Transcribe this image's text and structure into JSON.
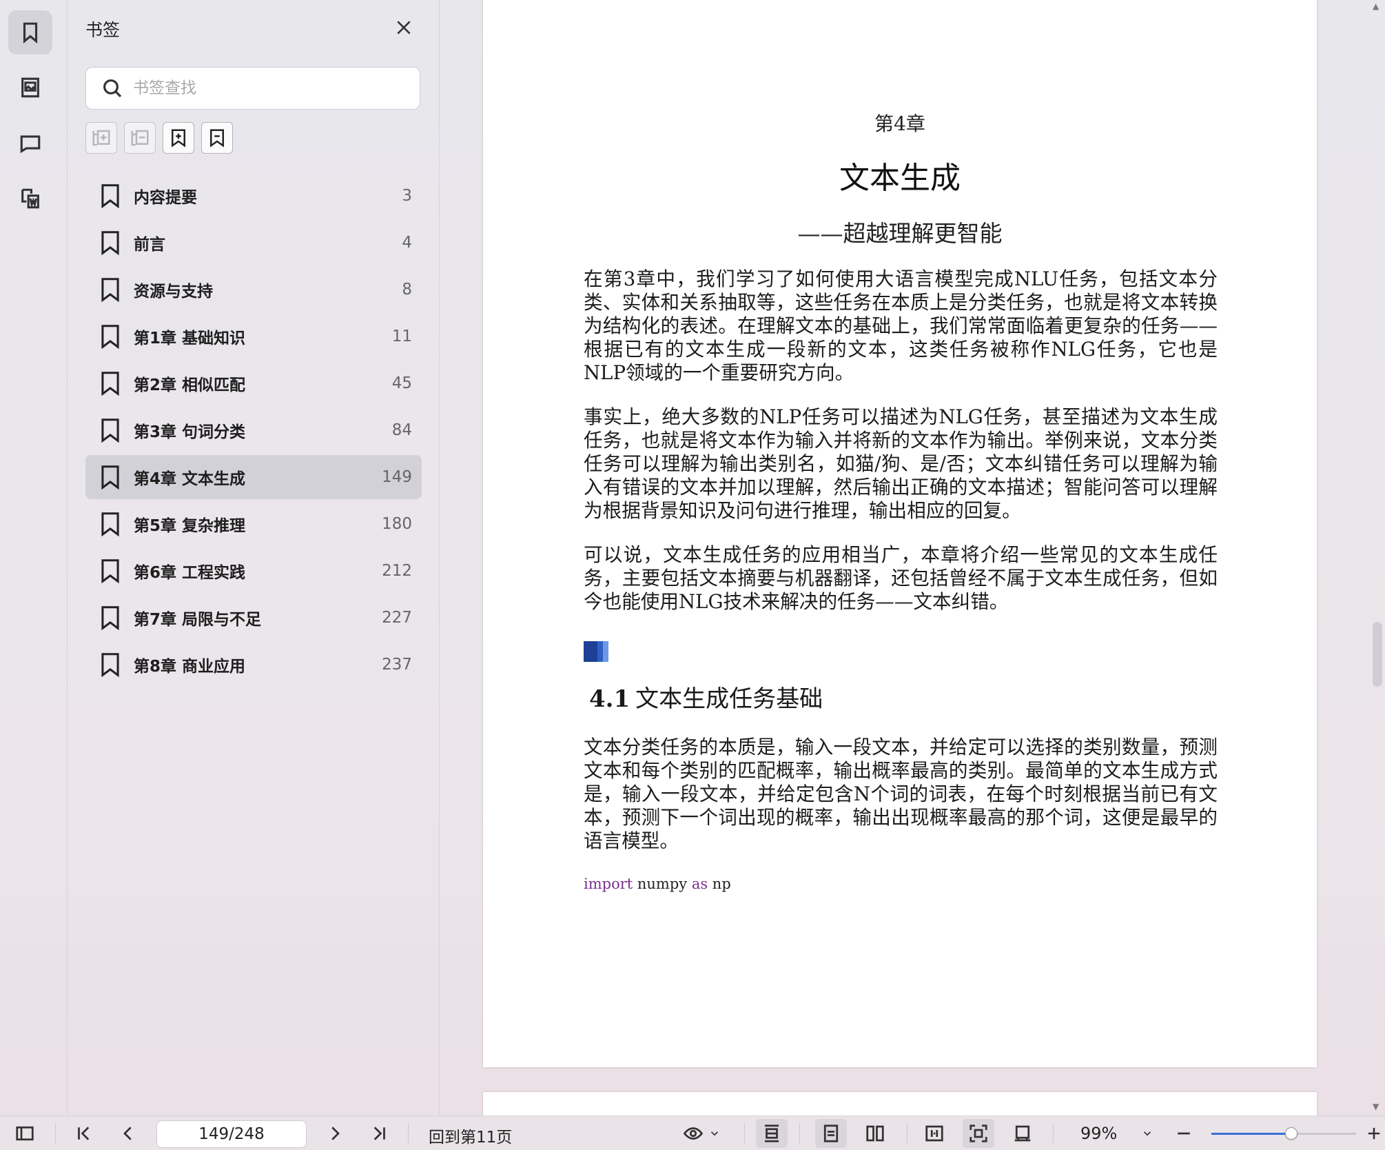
{
  "sidebar_panel": {
    "title": "书签",
    "search_placeholder": "书签查找",
    "items": [
      {
        "label": "内容提要",
        "page": "3"
      },
      {
        "label": "前言",
        "page": "4"
      },
      {
        "label": "资源与支持",
        "page": "8"
      },
      {
        "label": "第1章 基础知识",
        "page": "11"
      },
      {
        "label": "第2章 相似匹配",
        "page": "45"
      },
      {
        "label": "第3章 句词分类",
        "page": "84"
      },
      {
        "label": "第4章 文本生成",
        "page": "149"
      },
      {
        "label": "第5章 复杂推理",
        "page": "180"
      },
      {
        "label": "第6章 工程实践",
        "page": "212"
      },
      {
        "label": "第7章 局限与不足",
        "page": "227"
      },
      {
        "label": "第8章 商业应用",
        "page": "237"
      }
    ],
    "selected_index": 6
  },
  "document": {
    "chapter_number": "第4章",
    "chapter_title": "文本生成",
    "chapter_subtitle": "——超越理解更智能",
    "paragraphs": [
      "在第3章中，我们学习了如何使用大语言模型完成NLU任务，包括文本分类、实体和关系抽取等，这些任务在本质上是分类任务，也就是将文本转换为结构化的表述。在理解文本的基础上，我们常常面临着更复杂的任务——根据已有的文本生成一段新的文本，这类任务被称作NLG任务，它也是NLP领域的一个重要研究方向。",
      "事实上，绝大多数的NLP任务可以描述为NLG任务，甚至描述为文本生成任务，也就是将文本作为输入并将新的文本作为输出。举例来说，文本分类任务可以理解为输出类别名，如猫/狗、是/否；文本纠错任务可以理解为输入有错误的文本并加以理解，然后输出正确的文本描述；智能问答可以理解为根据背景知识及问句进行推理，输出相应的回复。",
      "可以说，文本生成任务的应用相当广，本章将介绍一些常见的文本生成任务，主要包括文本摘要与机器翻译，还包括曾经不属于文本生成任务，但如今也能使用NLG技术来解决的任务——文本纠错。"
    ],
    "section_number": "4.1",
    "section_title": "文本生成任务基础",
    "section_paragraph": "文本分类任务的本质是，输入一段文本，并给定可以选择的类别数量，预测文本和每个类别的匹配概率，输出概率最高的类别。最简单的文本生成方式是，输入一段文本，并给定包含N个词的词表，在每个时刻根据当前已有文本，预测下一个词出现的概率，输出出现概率最高的那个词，这便是最早的语言模型。",
    "code": {
      "kw1": "import",
      "mod": " numpy ",
      "kw2": "as",
      "alias": " np"
    }
  },
  "bottom_bar": {
    "page_indicator": "149/248",
    "back_link": "回到第11页",
    "zoom": "99%",
    "zoom_level": 0.55
  },
  "colors": {
    "selected_bg": "#d3d1d8",
    "accent": "#3a6fd8",
    "section_mark": [
      "#1d3f95",
      "#2f5fc2",
      "#6d98e6"
    ],
    "code_keyword": "#7a2f8f"
  }
}
